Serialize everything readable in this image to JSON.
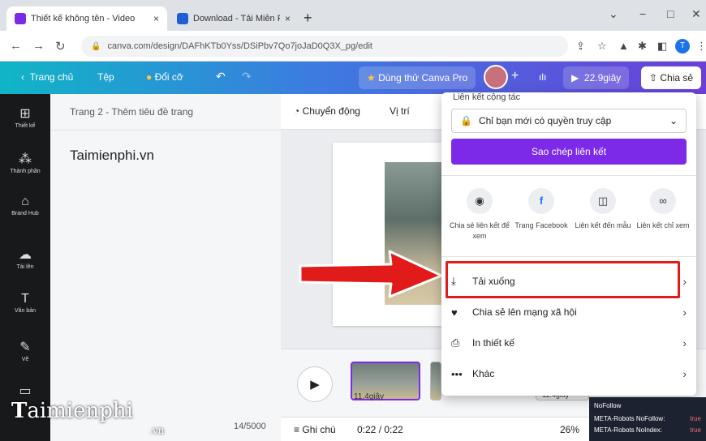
{
  "browser": {
    "tabs": [
      {
        "title": "Thiết kế không tên - Video",
        "close": "×"
      },
      {
        "title": "Download - Tải Miễn Phí VN - Ph",
        "close": "×"
      }
    ],
    "new_tab": "+",
    "window_controls": [
      "⌄",
      "−",
      "□",
      "✕"
    ],
    "url": "canva.com/design/DAFhKTb0Yss/DSiPbv7Qo7joJaD0Q3X_pg/edit",
    "profile_initial": "T"
  },
  "header": {
    "back_label": "Trang chủ",
    "file_label": "Tệp",
    "resize_label": "Đổi cỡ",
    "try_pro_label": "Dùng thử Canva Pro",
    "plus": "+",
    "duration_label": "22.9giây",
    "share_label": "Chia sẻ"
  },
  "rail": [
    {
      "icon": "layout-icon",
      "glyph": "⊞",
      "label": "Thiết kế"
    },
    {
      "icon": "elements-icon",
      "glyph": "⁂",
      "label": "Thành phần"
    },
    {
      "icon": "brand-hub-icon",
      "glyph": "⌂",
      "label": "Brand Hub"
    },
    {
      "icon": "upload-icon",
      "glyph": "☁",
      "label": "Tải lên"
    },
    {
      "icon": "text-icon",
      "glyph": "T",
      "label": "Văn bản"
    },
    {
      "icon": "draw-icon",
      "glyph": "✎",
      "label": "Vẽ"
    },
    {
      "icon": "folder-icon",
      "glyph": "▭",
      "label": ""
    }
  ],
  "editor": {
    "page_title": "Trang 2 - Thêm tiêu đề trang",
    "body_text": "Taimienphi.vn",
    "char_count": "14/5000",
    "toolbar": {
      "animate": "Chuyển động",
      "position": "Vị trí"
    },
    "clip_duration": "11.4giây",
    "clip_duration_2": "11.4giây",
    "notes_label": "Ghi chú",
    "time": "0:22 / 0:22",
    "zoom": "26%"
  },
  "share_panel": {
    "heading": "Liên kết cộng tác",
    "access_label": "Chỉ bạn mới có quyền truy cập",
    "copy_link_label": "Sao chép liên kết",
    "options": [
      {
        "icon": "eye-icon",
        "glyph": "◉",
        "label": "Chia sẻ liên kết để xem"
      },
      {
        "icon": "facebook-icon",
        "glyph": "f",
        "label": "Trang Facebook"
      },
      {
        "icon": "template-link-icon",
        "glyph": "◫",
        "label": "Liên kết đến mẫu"
      },
      {
        "icon": "view-only-link-icon",
        "glyph": "∞",
        "label": "Liên kết chỉ xem"
      }
    ],
    "rows": [
      {
        "icon": "download-icon",
        "glyph": "⤓",
        "label": "Tải xuống"
      },
      {
        "icon": "social-share-icon",
        "glyph": "♥",
        "label": "Chia sẻ lên mạng xã hội"
      },
      {
        "icon": "print-icon",
        "glyph": "⎙",
        "label": "In thiết kế"
      },
      {
        "icon": "more-icon",
        "glyph": "•••",
        "label": "Khác"
      }
    ],
    "chevron": "›"
  },
  "seo_overlay": {
    "title": "NoFollow",
    "rows": [
      {
        "label": "META-Robots NoFollow:",
        "value": "true"
      },
      {
        "label": "META-Robots NoIndex:",
        "value": "true"
      }
    ]
  },
  "watermark": {
    "main": "aimienphi",
    "letter": "T",
    "suffix": ".vn"
  },
  "colors": {
    "accent_purple": "#7d2ae8",
    "highlight_red": "#e11a1a"
  }
}
